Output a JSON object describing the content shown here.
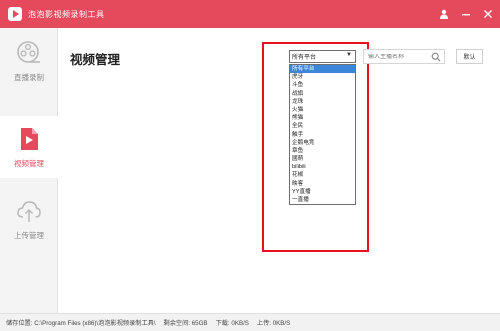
{
  "window": {
    "title": "泡泡影视频录制工具",
    "controls": [
      "user-icon",
      "minimize-icon",
      "close-icon"
    ]
  },
  "sidebar": {
    "items": [
      {
        "label": "直播录制",
        "icon": "film-reel-icon",
        "active": false
      },
      {
        "label": "视频管理",
        "icon": "video-file-icon",
        "active": true
      },
      {
        "label": "上传管理",
        "icon": "cloud-upload-icon",
        "active": false
      }
    ]
  },
  "main": {
    "title": "视频管理",
    "platform_select": {
      "selected": "所有平台",
      "options": [
        "所有平台",
        "虎牙",
        "斗鱼",
        "战旗",
        "龙珠",
        "火猫",
        "熊猫",
        "全民",
        "触手",
        "企鹅电竞",
        "章鱼",
        "國萌",
        "bilibili",
        "花椒",
        "映客",
        "YY直播",
        "一直播"
      ]
    },
    "search": {
      "placeholder": "输入主播名称",
      "value": ""
    },
    "default_button": "默认"
  },
  "statusbar": {
    "path": "储存位置: C:\\Program Files (x86)\\泡泡影视频录制工具\\",
    "free_space": "剩余空间: 65GB",
    "download": "下载: 0KB/S",
    "upload": "上传: 0KB/S"
  },
  "colors": {
    "accent": "#e54a5c",
    "highlight_box": "#e8121f",
    "selected_option": "#3a86d8"
  }
}
